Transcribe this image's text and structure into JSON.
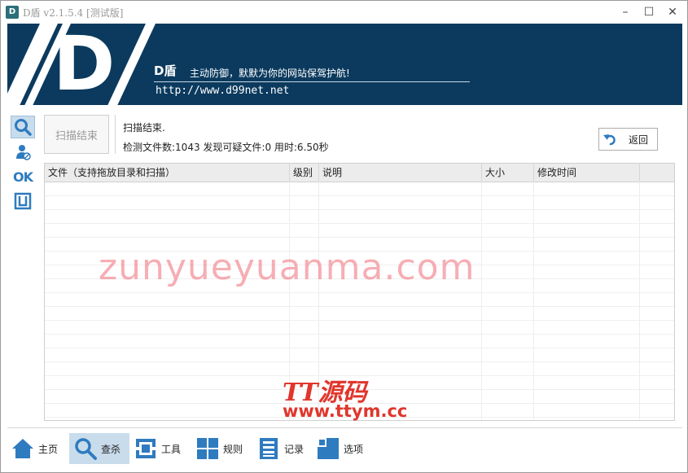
{
  "window": {
    "icon_text": "D",
    "title": "D盾 v2.1.5.4 [测试版]",
    "controls": {
      "minimize": "–",
      "maximize": "☐",
      "close": "✕"
    }
  },
  "banner": {
    "logo_letter": "D",
    "brand": "D盾",
    "slogan": "主动防御，默默为你的网站保驾护航!",
    "url": "http://www.d99net.net"
  },
  "side_toolbar": [
    {
      "icon": "search-icon",
      "active": true
    },
    {
      "icon": "user-block-icon",
      "active": false
    },
    {
      "icon": "ok-icon",
      "label": "OK",
      "active": false
    },
    {
      "icon": "bracket-icon",
      "active": false
    }
  ],
  "scan": {
    "button_label": "扫描结束",
    "status_line1": "扫描结束.",
    "status_line2": "检测文件数:1043 发现可疑文件:0 用时:6.50秒",
    "back_label": "返回"
  },
  "table": {
    "columns": [
      "文件（支持拖放目录和扫描）",
      "级别",
      "说明",
      "大小",
      "修改时间"
    ],
    "rows": []
  },
  "watermarks": {
    "line1": "zunyueyuanma.com",
    "line2": "TT源码",
    "line3": "www.ttym.cc"
  },
  "bottom_nav": [
    {
      "label": "主页",
      "icon": "home-icon",
      "active": false
    },
    {
      "label": "查杀",
      "icon": "search-icon",
      "active": true
    },
    {
      "label": "工具",
      "icon": "tool-icon",
      "active": false
    },
    {
      "label": "规则",
      "icon": "grid-icon",
      "active": false
    },
    {
      "label": "记录",
      "icon": "list-icon",
      "active": false
    },
    {
      "label": "选项",
      "icon": "options-icon",
      "active": false
    }
  ],
  "colors": {
    "banner": "#0b3a5e",
    "accent": "#2f7bbf",
    "active_bg": "#c9dcec"
  }
}
